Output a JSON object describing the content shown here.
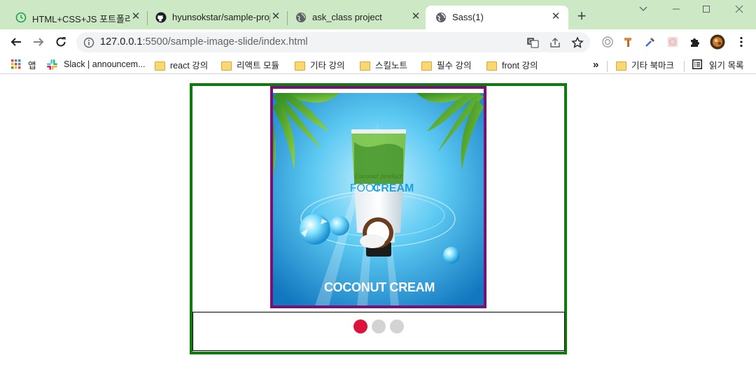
{
  "browser": {
    "tabs": [
      {
        "title": "HTML+CSS+JS 포트폴리",
        "icon": "tab-favicon-clock",
        "active": false
      },
      {
        "title": "hyunsokstar/sample-proj",
        "icon": "github-icon",
        "active": false
      },
      {
        "title": "ask_class project",
        "icon": "globe-icon",
        "active": false
      },
      {
        "title": "Sass(1)",
        "icon": "globe-icon",
        "active": true
      }
    ],
    "new_tab_label": "+",
    "url_host": "127.0.0.1",
    "url_rest": ":5500/sample-image-slide/index.html"
  },
  "bookmarks": {
    "items": [
      {
        "label": "앱",
        "icon": "apps-grid-icon"
      },
      {
        "label": "Slack | announcem...",
        "icon": "slack-icon"
      },
      {
        "label": "react 강의",
        "icon": "folder-icon"
      },
      {
        "label": "리액트 모듈",
        "icon": "folder-icon"
      },
      {
        "label": "기타 강의",
        "icon": "folder-icon"
      },
      {
        "label": "스킬노트",
        "icon": "folder-icon"
      },
      {
        "label": "필수 강의",
        "icon": "folder-icon"
      },
      {
        "label": "front 강의",
        "icon": "folder-icon"
      }
    ],
    "overflow_label": "»",
    "other_folder": "기타 북마크",
    "reading_list": "읽기 목록"
  },
  "slider": {
    "image_caption": "COCONUT CREAM",
    "product_line": "Coconut product",
    "product_name_a": "FOOT",
    "product_name_b": "CREAM",
    "active_index": 0,
    "dot_colors": {
      "active": "#dc143c",
      "inactive": "#d3d3d3"
    },
    "dots": [
      {
        "index": 0,
        "active": true
      },
      {
        "index": 1,
        "active": false
      },
      {
        "index": 2,
        "active": false
      }
    ]
  },
  "colors": {
    "tabstrip": "#cce8c4",
    "slider_border": "#0a7d0a",
    "slide_border": "#7b0f78"
  }
}
